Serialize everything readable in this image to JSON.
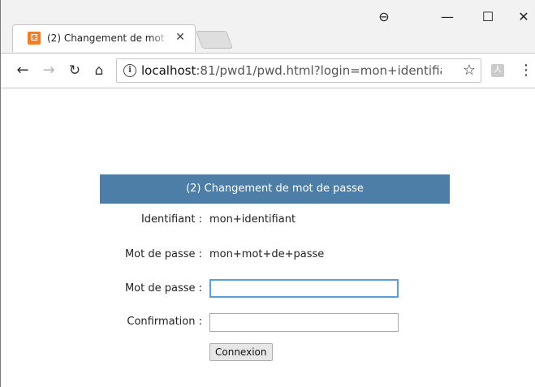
{
  "browser": {
    "tab": {
      "title": "(2) Changement de mot de passe",
      "close_glyph": "✕",
      "favicon_glyph": "⚃"
    },
    "window_controls": {
      "profile_glyph": "⊖",
      "minimize_glyph": "—",
      "maximize_glyph": "☐",
      "close_glyph": "✕"
    },
    "toolbar": {
      "back_glyph": "←",
      "forward_glyph": "→",
      "reload_glyph": "↻",
      "home_glyph": "⌂",
      "info_glyph": "i",
      "url_host": "localhost",
      "url_rest": ":81/pwd1/pwd.html?login=mon+identifiant...",
      "star_glyph": "☆",
      "menu_glyph": "⋮",
      "ext_glyph": "人"
    }
  },
  "form": {
    "header": "(2) Changement de mot de passe",
    "identifiant_label": "Identifiant :",
    "identifiant_value": "mon+identifiant",
    "password_label": "Mot de passe :",
    "password_value": "mon+mot+de+passe",
    "new_password_label": "Mot de passe :",
    "new_password_value": "",
    "confirmation_label": "Confirmation :",
    "confirmation_value": "",
    "submit_label": "Connexion"
  },
  "colors": {
    "header_bg": "#4d7ea8",
    "focus_ring": "#5b9dd9",
    "favicon": "#f57d1f"
  }
}
